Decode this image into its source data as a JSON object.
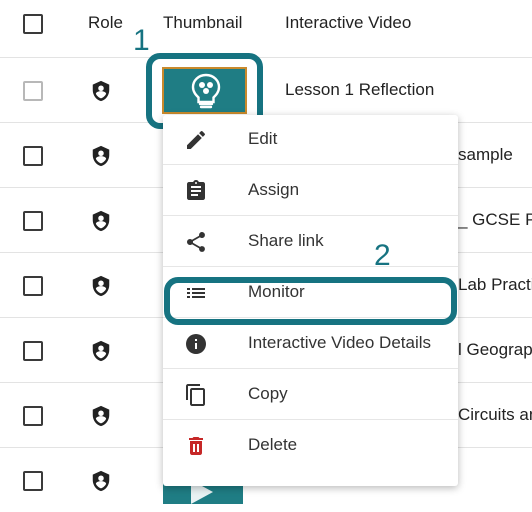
{
  "header": {
    "role_label": "Role",
    "thumbnail_label": "Thumbnail",
    "title_label": "Interactive Video"
  },
  "rows": [
    {
      "title": "Lesson 1 Reflection"
    },
    {
      "title": "sample"
    },
    {
      "title": "_ GCSE Ph"
    },
    {
      "title": "Lab Practic"
    },
    {
      "title": "l Geograph"
    },
    {
      "title": "Circuits an"
    },
    {
      "title": ""
    }
  ],
  "callouts": {
    "one": "1",
    "two": "2"
  },
  "menu": {
    "items": [
      {
        "label": "Edit",
        "icon": "pencil-icon"
      },
      {
        "label": "Assign",
        "icon": "clipboard-icon"
      },
      {
        "label": "Share link",
        "icon": "share-icon"
      },
      {
        "label": "Monitor",
        "icon": "list-icon"
      },
      {
        "label": "Interactive Video Details",
        "icon": "info-icon"
      },
      {
        "label": "Copy",
        "icon": "copy-icon"
      },
      {
        "label": "Delete",
        "icon": "trash-icon"
      }
    ]
  },
  "colors": {
    "accent": "#167381",
    "thumbnail_bg": "#1f7d84",
    "thumbnail_border": "#c98a2c",
    "delete_icon": "#c62828",
    "menu_icon": "#333333"
  }
}
